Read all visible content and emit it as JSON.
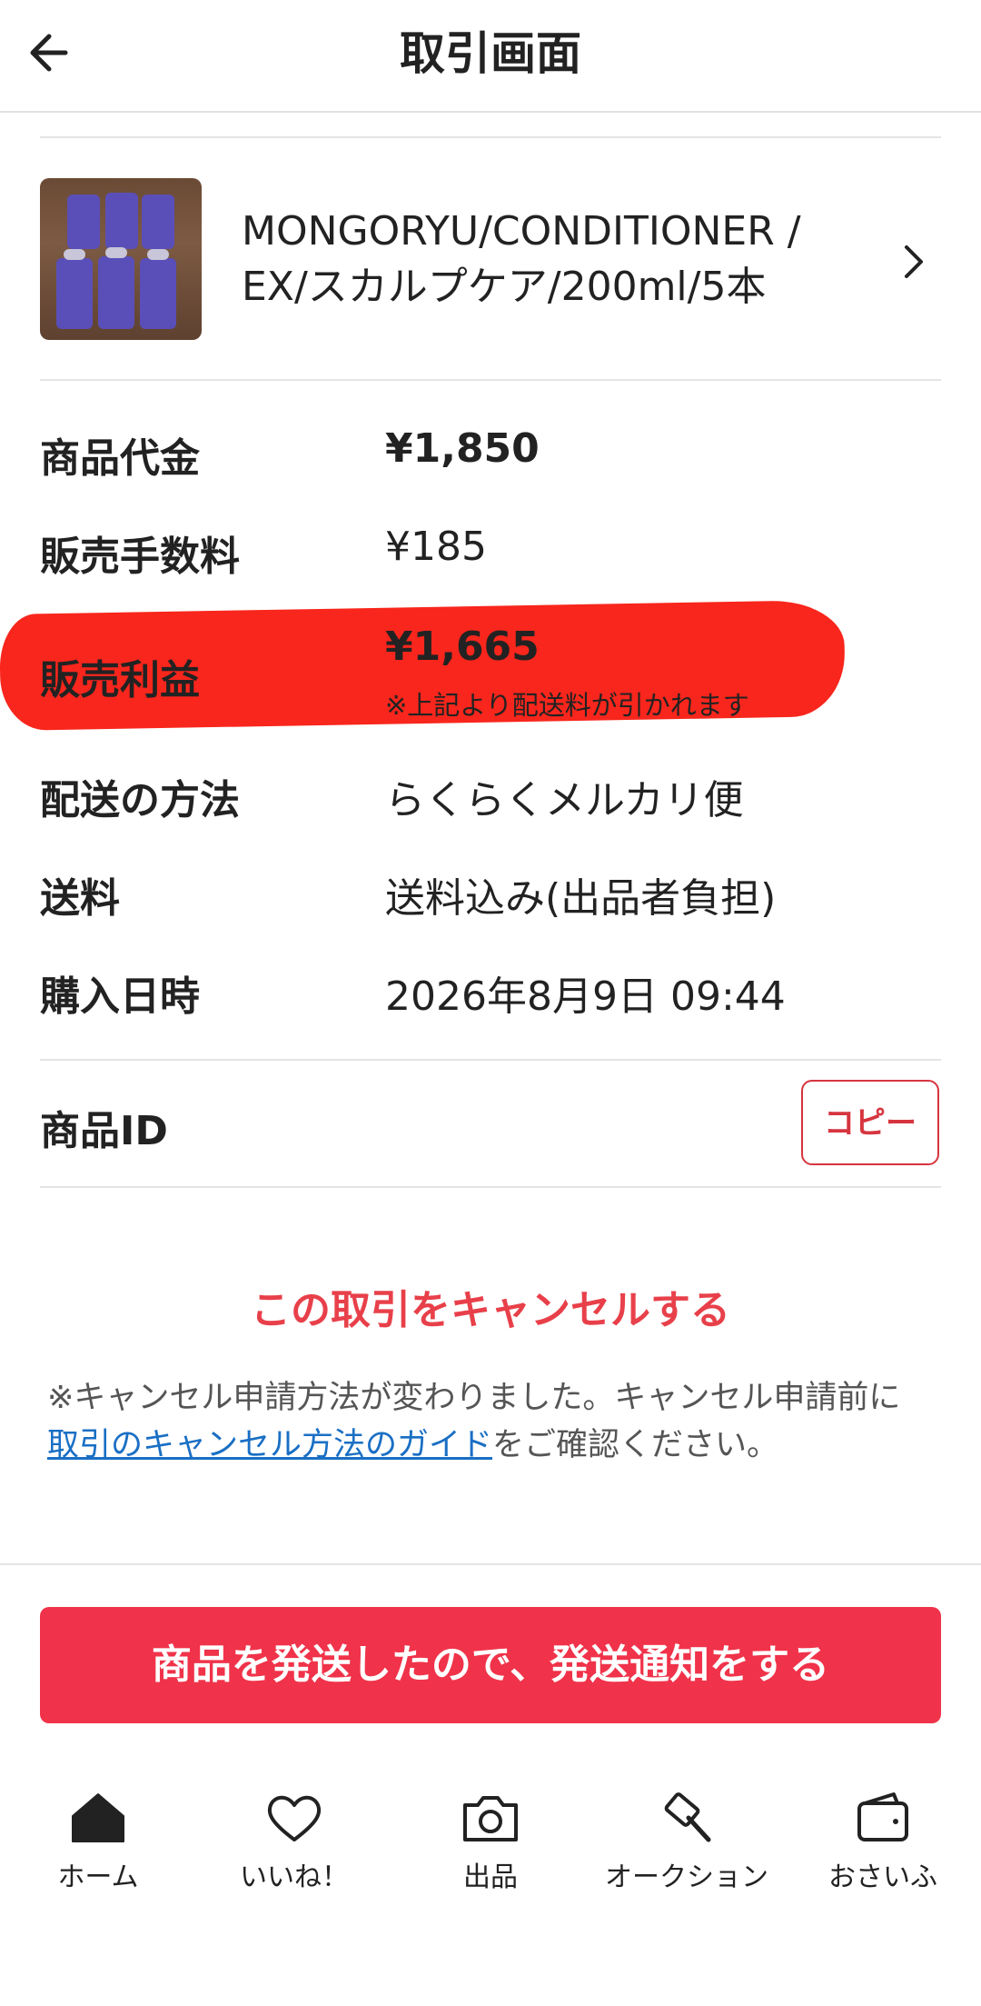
{
  "header": {
    "title": "取引画面"
  },
  "product": {
    "name_line1": "MONGORYU/CONDITIONER /",
    "name_line2": "EX/スカルプケア/200ml/5本"
  },
  "info": [
    {
      "label": "商品代金",
      "value": "¥1,850"
    },
    {
      "label": "販売手数料",
      "value": "¥185"
    },
    {
      "label": "販売利益",
      "value": "¥1,665",
      "note": "※上記より配送料が引かれます"
    },
    {
      "label": "配送の方法",
      "value": "らくらくメルカリ便"
    },
    {
      "label": "送料",
      "value": "送料込み(出品者負担)"
    },
    {
      "label": "購入日時",
      "value": "2026年8月9日 09:44"
    }
  ],
  "product_id": {
    "label": "商品ID",
    "copy_label": "コピー"
  },
  "cancel": {
    "link_label": "この取引をキャンセルする",
    "note_prefix": "※キャンセル申請方法が変わりました。キャンセル申請前に",
    "note_link": "取引のキャンセル方法のガイド",
    "note_suffix": "をご確認ください。"
  },
  "ship_button_label": "商品を発送したので、発送通知をする",
  "tabs": [
    {
      "label": "ホーム",
      "icon": "home-icon"
    },
    {
      "label": "いいね！",
      "icon": "heart-icon"
    },
    {
      "label": "出品",
      "icon": "camera-icon"
    },
    {
      "label": "オークション",
      "icon": "gavel-icon"
    },
    {
      "label": "おさいふ",
      "icon": "wallet-icon"
    }
  ],
  "colors": {
    "accent": "#f0334a",
    "highlight": "#f8261c",
    "link": "#1a6fc4"
  }
}
